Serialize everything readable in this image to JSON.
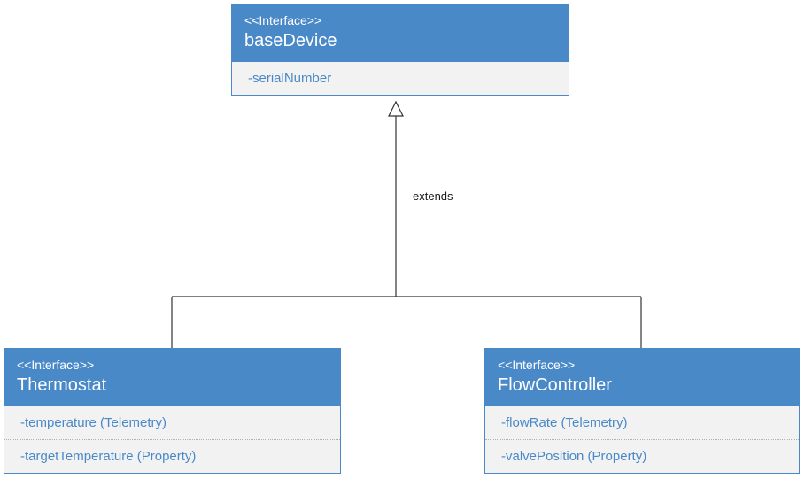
{
  "base": {
    "stereotype": "<<Interface>>",
    "name": "baseDevice",
    "attrs": [
      "-serialNumber"
    ]
  },
  "left": {
    "stereotype": "<<Interface>>",
    "name": "Thermostat",
    "attrs": [
      "-temperature (Telemetry)",
      "-targetTemperature (Property)"
    ]
  },
  "right": {
    "stereotype": "<<Interface>>",
    "name": "FlowController",
    "attrs": [
      "-flowRate (Telemetry)",
      "-valvePosition (Property)"
    ]
  },
  "relation": {
    "label": "extends"
  }
}
